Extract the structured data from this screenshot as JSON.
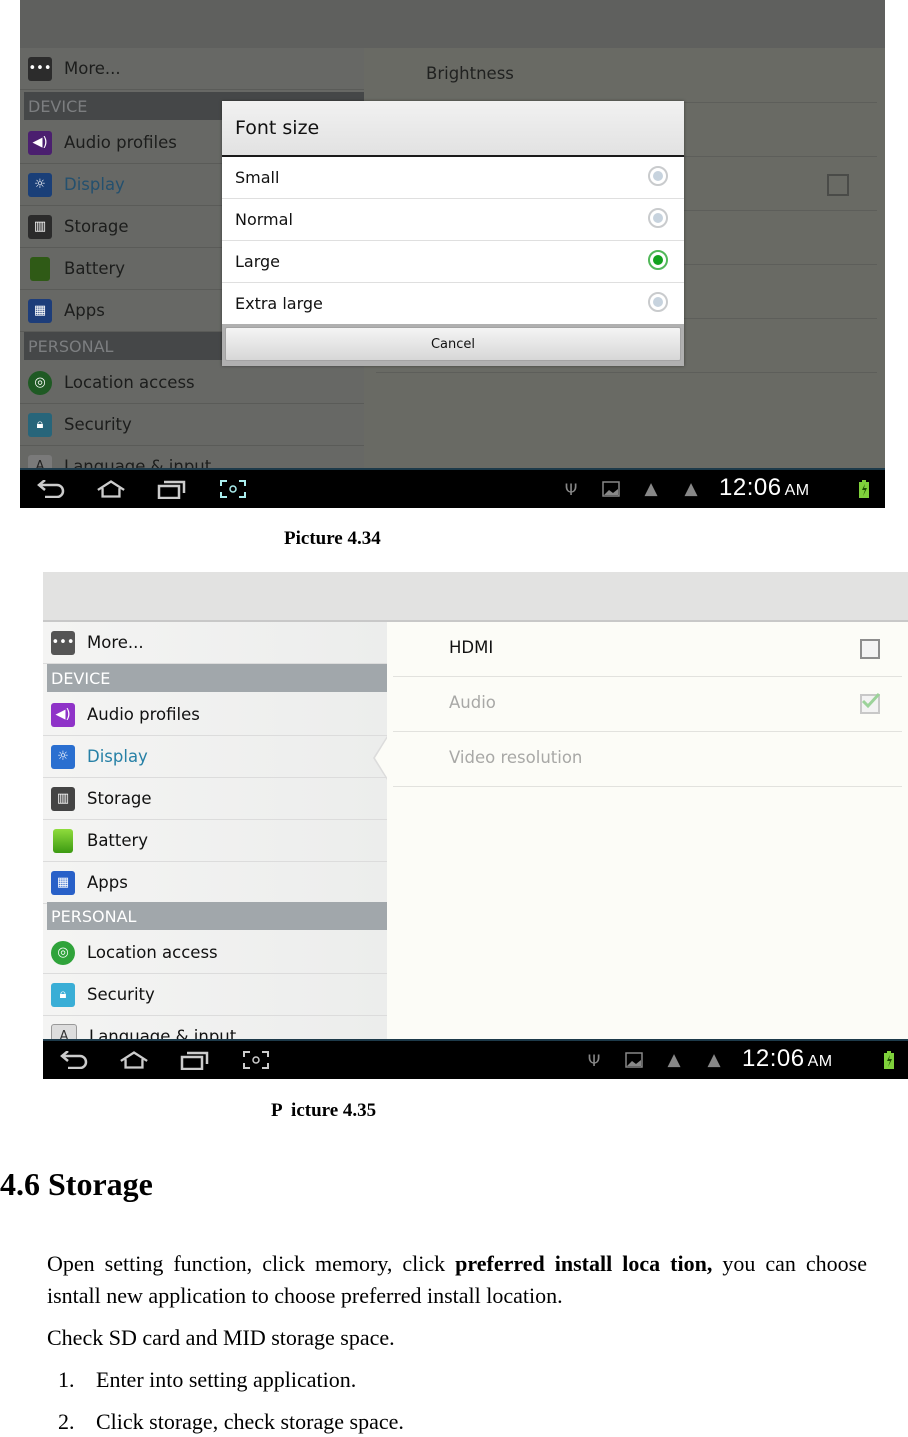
{
  "figures": [
    {
      "caption": "Picture 4.34",
      "sidebar": {
        "items": [
          {
            "type": "item",
            "label": "More...",
            "icon": "more-icon"
          },
          {
            "type": "header",
            "label": "DEVICE"
          },
          {
            "type": "item",
            "label": "Audio profiles",
            "icon": "speaker-icon"
          },
          {
            "type": "item",
            "label": "Display",
            "icon": "display-icon",
            "selected": true
          },
          {
            "type": "item",
            "label": "Storage",
            "icon": "sd-card-icon"
          },
          {
            "type": "item",
            "label": "Battery",
            "icon": "battery-icon"
          },
          {
            "type": "item",
            "label": "Apps",
            "icon": "apps-grid-icon"
          },
          {
            "type": "header",
            "label": "PERSONAL"
          },
          {
            "type": "item",
            "label": "Location access",
            "icon": "location-icon"
          },
          {
            "type": "item",
            "label": "Security",
            "icon": "lock-icon"
          },
          {
            "type": "item",
            "label": "Language & input",
            "icon": "language-icon"
          }
        ]
      },
      "detail": {
        "items": [
          {
            "label": "Brightness"
          }
        ]
      },
      "dialog": {
        "title": "Font size",
        "options": [
          {
            "label": "Small",
            "selected": false
          },
          {
            "label": "Normal",
            "selected": false
          },
          {
            "label": "Large",
            "selected": true
          },
          {
            "label": "Extra large",
            "selected": false
          }
        ],
        "cancel_label": "Cancel"
      },
      "statusbar": {
        "time": "12:06",
        "ampm": "AM"
      }
    },
    {
      "caption": "P  icture 4.35",
      "sidebar": {
        "items": [
          {
            "type": "item",
            "label": "More...",
            "icon": "more-icon"
          },
          {
            "type": "header",
            "label": "DEVICE"
          },
          {
            "type": "item",
            "label": "Audio profiles",
            "icon": "speaker-icon"
          },
          {
            "type": "item",
            "label": "Display",
            "icon": "display-icon",
            "selected": true
          },
          {
            "type": "item",
            "label": "Storage",
            "icon": "sd-card-icon"
          },
          {
            "type": "item",
            "label": "Battery",
            "icon": "battery-icon"
          },
          {
            "type": "item",
            "label": "Apps",
            "icon": "apps-grid-icon"
          },
          {
            "type": "header",
            "label": "PERSONAL"
          },
          {
            "type": "item",
            "label": "Location access",
            "icon": "location-icon"
          },
          {
            "type": "item",
            "label": "Security",
            "icon": "lock-icon"
          },
          {
            "type": "item",
            "label": "Language & input",
            "icon": "language-icon"
          }
        ]
      },
      "detail": {
        "items": [
          {
            "label": "HDMI",
            "checkbox": "unchecked",
            "enabled": true
          },
          {
            "label": "Audio",
            "checkbox": "checked",
            "enabled": false
          },
          {
            "label": "Video resolution",
            "enabled": false
          }
        ]
      },
      "statusbar": {
        "time": "12:06",
        "ampm": "AM"
      }
    }
  ],
  "section": {
    "heading": "4.6 Storage",
    "para1_pre": "Open setting function, click memory, click ",
    "para1_bold": "preferred install loca tion,",
    "para1_post": " you can choose isntall new application to choose preferred install location.",
    "para2": "Check SD card and MID storage space.",
    "steps": [
      {
        "num": "1.",
        "text": "Enter into setting application."
      },
      {
        "num": "2.",
        "text": "Click storage, check storage space."
      }
    ]
  }
}
